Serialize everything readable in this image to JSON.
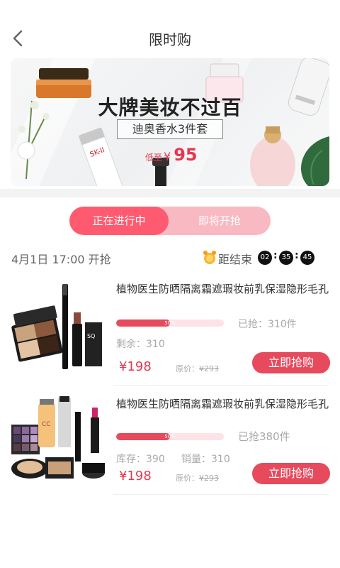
{
  "header": {
    "title": "限时购",
    "back_icon": "chevron-left-icon"
  },
  "banner": {
    "headline": "大牌美妆不过百",
    "subtitle": "迪奥香水3件套",
    "price_prefix": "低至",
    "currency": "¥",
    "price": "95"
  },
  "tabs": [
    {
      "label": "正在进行中",
      "active": true
    },
    {
      "label": "即将开抢",
      "active": false
    }
  ],
  "session": {
    "start_text": "4月1日 17:00 开抢",
    "countdown_label": "距结束",
    "countdown": {
      "hours": "02",
      "minutes": "35",
      "seconds": "45"
    },
    "alarm_icon": "alarm-clock-icon"
  },
  "products": [
    {
      "title": "植物医生防晒隔离霜遮瑕妆前乳保湿隐形毛孔",
      "progress": 0.5,
      "progress_label": "50%",
      "sold_text": "已抢：310件",
      "remain_text": "剩余：310",
      "stock_text": "",
      "sales_text": "",
      "price": "¥198",
      "orig_label": "原价：",
      "orig_price": "¥293",
      "buy_label": "立即抢购"
    },
    {
      "title": "植物医生防晒隔离霜遮瑕妆前乳保湿隐形毛孔",
      "progress": 0.5,
      "progress_label": "50%",
      "sold_text": "已抢380件",
      "remain_text": "",
      "stock_text": "库存：390",
      "sales_text": "销量：310",
      "price": "¥198",
      "orig_label": "原价：",
      "orig_price": "¥293",
      "buy_label": "立即抢购"
    }
  ],
  "colors": {
    "accent": "#e74a5d",
    "tab_active": "#ff5a6f",
    "tab_bg": "#f9b9c3"
  }
}
